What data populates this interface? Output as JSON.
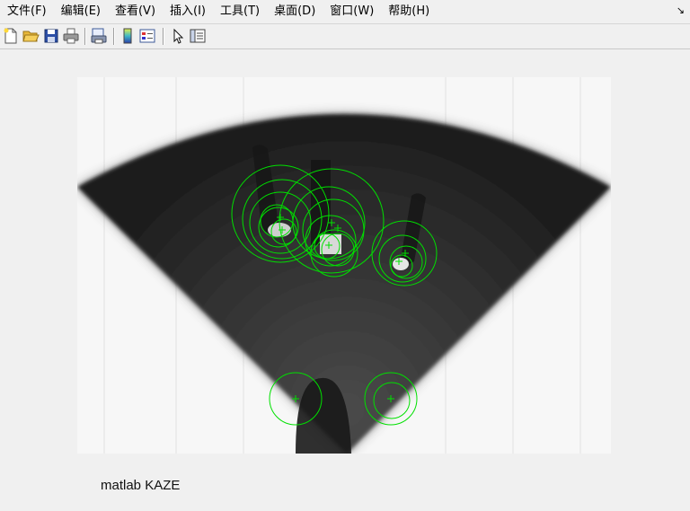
{
  "menubar": {
    "items": [
      {
        "label": "文件(F)"
      },
      {
        "label": "编辑(E)"
      },
      {
        "label": "查看(V)"
      },
      {
        "label": "插入(I)"
      },
      {
        "label": "工具(T)"
      },
      {
        "label": "桌面(D)"
      },
      {
        "label": "窗口(W)"
      },
      {
        "label": "帮助(H)"
      }
    ],
    "dock_icon": "↘"
  },
  "toolbar": {
    "buttons": [
      {
        "icon": "new-file-icon"
      },
      {
        "icon": "open-folder-icon"
      },
      {
        "icon": "save-icon"
      },
      {
        "icon": "print-icon"
      },
      {
        "icon": "print-preview-icon"
      },
      {
        "icon": "colorbar-icon"
      },
      {
        "icon": "legend-icon"
      },
      {
        "icon": "pointer-icon"
      },
      {
        "icon": "property-editor-icon"
      }
    ]
  },
  "figure": {
    "image": "sonar fan-shaped grayscale image",
    "marker_color": "#00e000"
  },
  "caption": "matlab KAZE"
}
